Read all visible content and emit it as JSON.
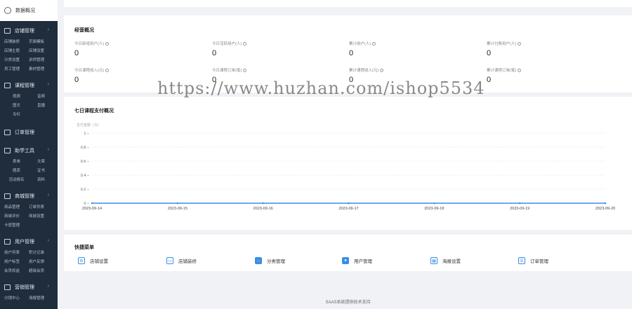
{
  "sidebar": {
    "active": {
      "label": "数据概况",
      "icon": "clock-icon"
    },
    "groups": [
      {
        "label": "店铺管理",
        "icon": "shop-icon",
        "items": [
          "店铺装修",
          "页面模板",
          "店铺主题",
          "店铺设置",
          "分类设置",
          "讲师管理",
          "员工管理",
          "素材管理"
        ]
      },
      {
        "label": "课程管理",
        "icon": "book-icon",
        "items": [
          "视频",
          "音频",
          "图文",
          "直播",
          "专栏"
        ]
      },
      {
        "label": "订单管理",
        "icon": "order-icon",
        "items": []
      },
      {
        "label": "助学工具",
        "icon": "tools-icon",
        "items": [
          "表单",
          "文章",
          "题库",
          "证书",
          "活动报名",
          "资料"
        ]
      },
      {
        "label": "商城管理",
        "icon": "mall-icon",
        "items": [
          "商品管理",
          "订单列表",
          "商城评价",
          "商城设置",
          "卡密管理"
        ]
      },
      {
        "label": "用户管理",
        "icon": "user-icon",
        "items": [
          "用户列表",
          "积分记录",
          "用户标签",
          "用户反馈",
          "会员权益",
          "超级会员"
        ]
      },
      {
        "label": "营销管理",
        "icon": "marketing-icon",
        "items": [
          "分销中心",
          "海报管理"
        ]
      }
    ]
  },
  "overview": {
    "title": "经营概况",
    "stats": [
      {
        "label": "今日新增用户(人)",
        "value": "0"
      },
      {
        "label": "今日活跃用户(人)",
        "value": "0"
      },
      {
        "label": "累计用户(人)",
        "value": "0"
      },
      {
        "label": "累计付费用户(人)",
        "value": "0"
      },
      {
        "label": "今日课程收入(元)",
        "value": "0"
      },
      {
        "label": "今日课程订单(笔)",
        "value": "0"
      },
      {
        "label": "累计课程收入(元)",
        "value": "0"
      },
      {
        "label": "累计课程订单(笔)",
        "value": "0"
      }
    ]
  },
  "chart_section": {
    "title": "七日课程支付概况",
    "unit_label": "支付金额（元）"
  },
  "chart_data": {
    "type": "line",
    "x": [
      "2023-09-14",
      "2023-09-15",
      "2023-09-16",
      "2023-09-17",
      "2023-09-18",
      "2023-09-19",
      "2023-09-20"
    ],
    "series": [
      {
        "values": [
          0,
          0,
          0,
          0,
          0,
          0,
          0
        ]
      }
    ],
    "ylabel": "支付金额（元）",
    "ylim": [
      0,
      1
    ],
    "yticks": [
      "0",
      "0.2",
      "0.4",
      "0.6",
      "0.8",
      "1"
    ],
    "grid": true,
    "color": "#3a8ee6"
  },
  "quick_menu": {
    "title": "快捷菜单",
    "items": [
      {
        "label": "店铺设置",
        "icon": "gear-icon"
      },
      {
        "label": "店铺装修",
        "icon": "decorate-icon"
      },
      {
        "label": "分类管理",
        "icon": "category-icon"
      },
      {
        "label": "用户管理",
        "icon": "user-icon"
      },
      {
        "label": "海报设置",
        "icon": "poster-icon"
      },
      {
        "label": "订单管理",
        "icon": "order-icon"
      }
    ]
  },
  "footer": {
    "text": "SAAS系统提供技术支持"
  },
  "watermark": {
    "text": "https://www.huzhan.com/ishop5534"
  }
}
